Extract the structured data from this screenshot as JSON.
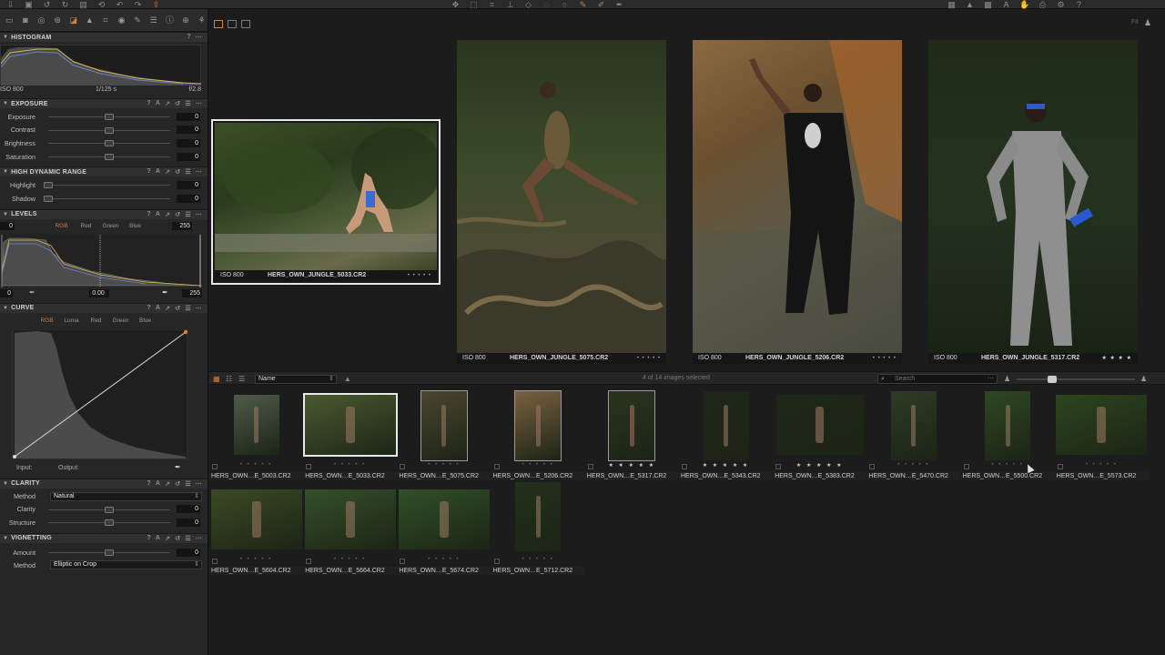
{
  "toolbar": {
    "left_icons": [
      "import-icon",
      "camera-icon",
      "undo-icon",
      "redo-icon",
      "copy-icon",
      "reset-icon",
      "undo-arrow-icon",
      "redo-arrow-icon",
      "export-icon"
    ],
    "center_icons": [
      "pan-icon",
      "select-icon",
      "crop-icon",
      "straighten-icon",
      "keystone-icon",
      "spot-icon",
      "color-picker-icon",
      "brush-icon",
      "eraser-icon",
      "gradient-icon"
    ],
    "right_icons": [
      "grid-icon",
      "warning-icon",
      "exposure-icon",
      "text-icon",
      "hand-icon",
      "zoom-slider",
      "print-icon",
      "settings-icon",
      "help-icon"
    ]
  },
  "left_panel": {
    "histogram": {
      "title": "HISTOGRAM",
      "iso": "ISO 800",
      "shutter": "1/125 s",
      "aperture": "f/2.8"
    },
    "exposure": {
      "title": "EXPOSURE",
      "sliders": [
        {
          "label": "Exposure",
          "value": "0"
        },
        {
          "label": "Contrast",
          "value": "0"
        },
        {
          "label": "Brightness",
          "value": "0"
        },
        {
          "label": "Saturation",
          "value": "0"
        }
      ]
    },
    "hdr": {
      "title": "HIGH DYNAMIC RANGE",
      "sliders": [
        {
          "label": "Highlight",
          "value": "0"
        },
        {
          "label": "Shadow",
          "value": "0"
        }
      ]
    },
    "levels": {
      "title": "LEVELS",
      "black_value": "0",
      "white_value": "255",
      "channels": [
        "RGB",
        "Red",
        "Green",
        "Blue"
      ],
      "out_black": "0",
      "midtone": "0.00",
      "out_white": "255"
    },
    "curve": {
      "title": "CURVE",
      "channels": [
        "RGB",
        "Luma",
        "Red",
        "Green",
        "Blue"
      ],
      "input_label": "Input:",
      "output_label": "Output:"
    },
    "clarity": {
      "title": "CLARITY",
      "method_label": "Method",
      "method_value": "Natural",
      "sliders": [
        {
          "label": "Clarity",
          "value": "0"
        },
        {
          "label": "Structure",
          "value": "0"
        }
      ]
    },
    "vignetting": {
      "title": "VIGNETTING",
      "amount_label": "Amount",
      "amount_value": "0",
      "method_label": "Method",
      "method_value": "Elliptic on Crop"
    }
  },
  "viewer": {
    "images": [
      {
        "iso": "ISO 800",
        "filename": "HERS_OWN_JUNGLE_5033.CR2",
        "stars": "• • • • •"
      },
      {
        "iso": "ISO 800",
        "filename": "HERS_OWN_JUNGLE_5075.CR2",
        "stars": "• • • • •"
      },
      {
        "iso": "ISO 800",
        "filename": "HERS_OWN_JUNGLE_5206.CR2",
        "stars": "• • • • •"
      },
      {
        "iso": "ISO 800",
        "filename": "HERS_OWN_JUNGLE_5317.CR2",
        "stars": "★ ★ ★ ★"
      }
    ]
  },
  "browser": {
    "sort_by": "Name",
    "selection_status": "4 of 14 images selected",
    "search_placeholder": "Search",
    "thumbnails": [
      {
        "name": "HERS_OWN…E_5003.CR2",
        "stars": "• • • • •",
        "rated": false
      },
      {
        "name": "HERS_OWN…E_5033.CR2",
        "stars": "• • • • •",
        "rated": false
      },
      {
        "name": "HERS_OWN…E_5075.CR2",
        "stars": "• • • • •",
        "rated": false
      },
      {
        "name": "HERS_OWN…E_5206.CR2",
        "stars": "• • • • •",
        "rated": false
      },
      {
        "name": "HERS_OWN…E_5317.CR2",
        "stars": "★ ★ ★ ★ ★",
        "rated": true
      },
      {
        "name": "HERS_OWN…E_5343.CR2",
        "stars": "★ ★ ★ ★ ★",
        "rated": true
      },
      {
        "name": "HERS_OWN…E_5383.CR2",
        "stars": "★ ★ ★ ★ ★",
        "rated": true
      },
      {
        "name": "HERS_OWN…E_5470.CR2",
        "stars": "• • • • •",
        "rated": false
      },
      {
        "name": "HERS_OWN…E_5500.CR2",
        "stars": "• • • • •",
        "rated": false
      },
      {
        "name": "HERS_OWN…E_5573.CR2",
        "stars": "• • • • •",
        "rated": false
      },
      {
        "name": "HERS_OWN…E_5604.CR2",
        "stars": "• • • • •",
        "rated": false
      },
      {
        "name": "HERS_OWN…E_5664.CR2",
        "stars": "• • • • •",
        "rated": false
      },
      {
        "name": "HERS_OWN…E_5674.CR2",
        "stars": "• • • • •",
        "rated": false
      },
      {
        "name": "HERS_OWN…E_5712.CR2",
        "stars": "• • • • •",
        "rated": false
      }
    ]
  },
  "colors": {
    "accent": "#e27a2a",
    "panel": "#262626",
    "background": "#1c1c1c"
  }
}
